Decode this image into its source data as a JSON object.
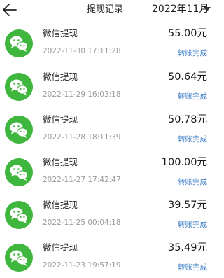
{
  "header": {
    "back_icon": "back-arrow-icon",
    "title": "提现记录",
    "month": "2022年11月",
    "month_dropdown_icon": "triangle-down-icon"
  },
  "colors": {
    "wechat_green": "#3fb63d",
    "status_blue": "#3f7fc7",
    "time_gray": "#9a9a9a"
  },
  "records": [
    {
      "icon": "wechat-icon",
      "name": "微信提现",
      "time": "2022-11-30 17:11:28",
      "amount": "55.00元",
      "status": "转账完成"
    },
    {
      "icon": "wechat-icon",
      "name": "微信提现",
      "time": "2022-11-29 16:03:18",
      "amount": "50.64元",
      "status": "转账完成"
    },
    {
      "icon": "wechat-icon",
      "name": "微信提现",
      "time": "2022-11-28 18:11:39",
      "amount": "50.78元",
      "status": "转账完成"
    },
    {
      "icon": "wechat-icon",
      "name": "微信提现",
      "time": "2022-11-27 17:42:47",
      "amount": "100.00元",
      "status": "转账完成"
    },
    {
      "icon": "wechat-icon",
      "name": "微信提现",
      "time": "2022-11-25 00:04:18",
      "amount": "39.57元",
      "status": "转账完成"
    },
    {
      "icon": "wechat-icon",
      "name": "微信提现",
      "time": "2022-11-23 19:57:19",
      "amount": "35.49元",
      "status": "转账完成"
    }
  ]
}
